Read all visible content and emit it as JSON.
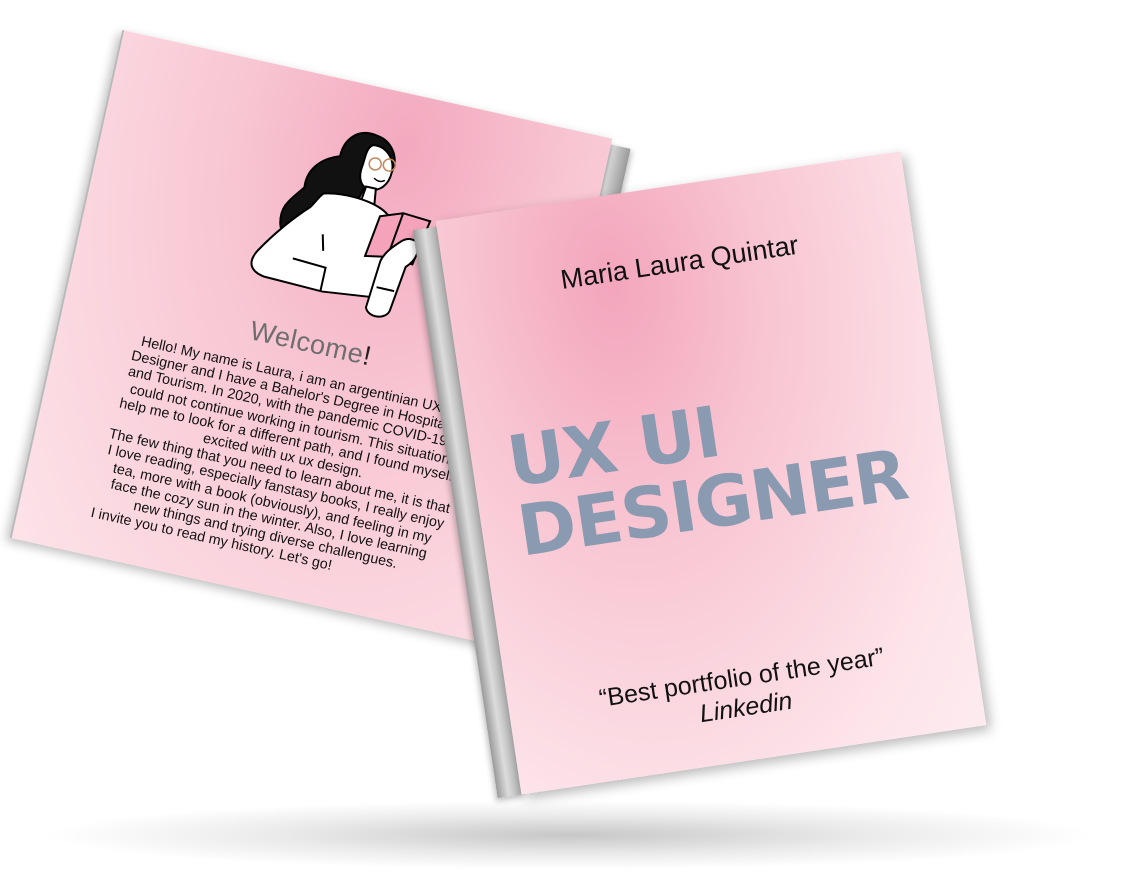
{
  "back_book": {
    "welcome_title": "Welcome",
    "welcome_mark": "!",
    "paragraph_1": "Hello! My name is Laura, i am an argentinian UX UI Designer and I have a Bahelor's Degree in Hospitality and Tourism. In 2020, with the pandemic COVID-19, I could not continue working in tourism. This situation help me to look for a different path, and I found myself excited with ux ux design.",
    "paragraph_2": "The few thing that you need to learn about me, it is that I love reading, especially fanstasy books, I really enjoy tea, more with a book (obviously), and feeling in my face the cozy sun in the winter. Also, I love learning new things and trying diverse challengues.",
    "paragraph_3": "I invite you to read my history. Let's go!",
    "illustration_icon": "woman-reading-book-icon"
  },
  "front_book": {
    "author": "Maria Laura Quintar",
    "headline_line_1": "UX UI",
    "headline_line_2": "DESIGNER",
    "quote_text": "“Best portfolio of the year”",
    "quote_source": "Linkedin",
    "headline_color": "#8a9ab0"
  },
  "colors": {
    "cover_pink": "#f8c5d2",
    "spine_gray": "#c4c4c4"
  }
}
